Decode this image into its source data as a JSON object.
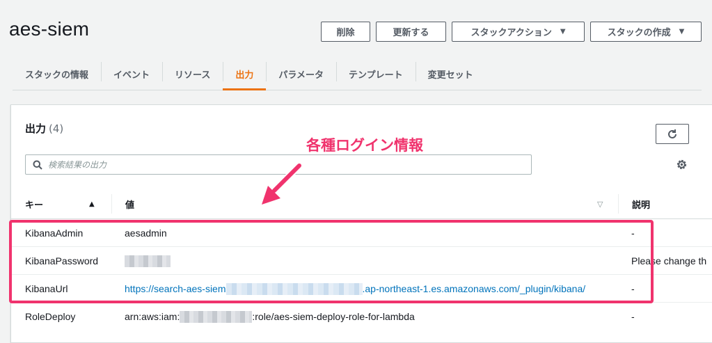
{
  "page": {
    "title": "aes-siem"
  },
  "header_actions": {
    "delete": "削除",
    "update": "更新する",
    "stack_actions": "スタックアクション",
    "create_stack": "スタックの作成"
  },
  "tabs": [
    {
      "label": "スタックの情報"
    },
    {
      "label": "イベント"
    },
    {
      "label": "リソース"
    },
    {
      "label": "出力",
      "active": true
    },
    {
      "label": "パラメータ"
    },
    {
      "label": "テンプレート"
    },
    {
      "label": "変更セット"
    }
  ],
  "outputs": {
    "title": "出力",
    "count": "(4)",
    "search_placeholder": "検索結果の出力",
    "columns": {
      "key": "キー",
      "value": "値",
      "description": "説明"
    },
    "rows": [
      {
        "key": "KibanaAdmin",
        "value": "aesadmin",
        "description": "-"
      },
      {
        "key": "KibanaPassword",
        "value": "",
        "description": "Please change th"
      },
      {
        "key": "KibanaUrl",
        "value_prefix": "https://search-aes-siem",
        "value_suffix": ".ap-northeast-1.es.amazonaws.com/_plugin/kibana/",
        "description": "-"
      },
      {
        "key": "RoleDeploy",
        "value_prefix": "arn:aws:iam:",
        "value_suffix": ":role/aes-siem-deploy-role-for-lambda",
        "description": "-"
      }
    ]
  },
  "annotation": {
    "text": "各種ログイン情報"
  },
  "colors": {
    "accent": "#ec7211",
    "link": "#0073bb",
    "annotation": "#f0336d"
  }
}
